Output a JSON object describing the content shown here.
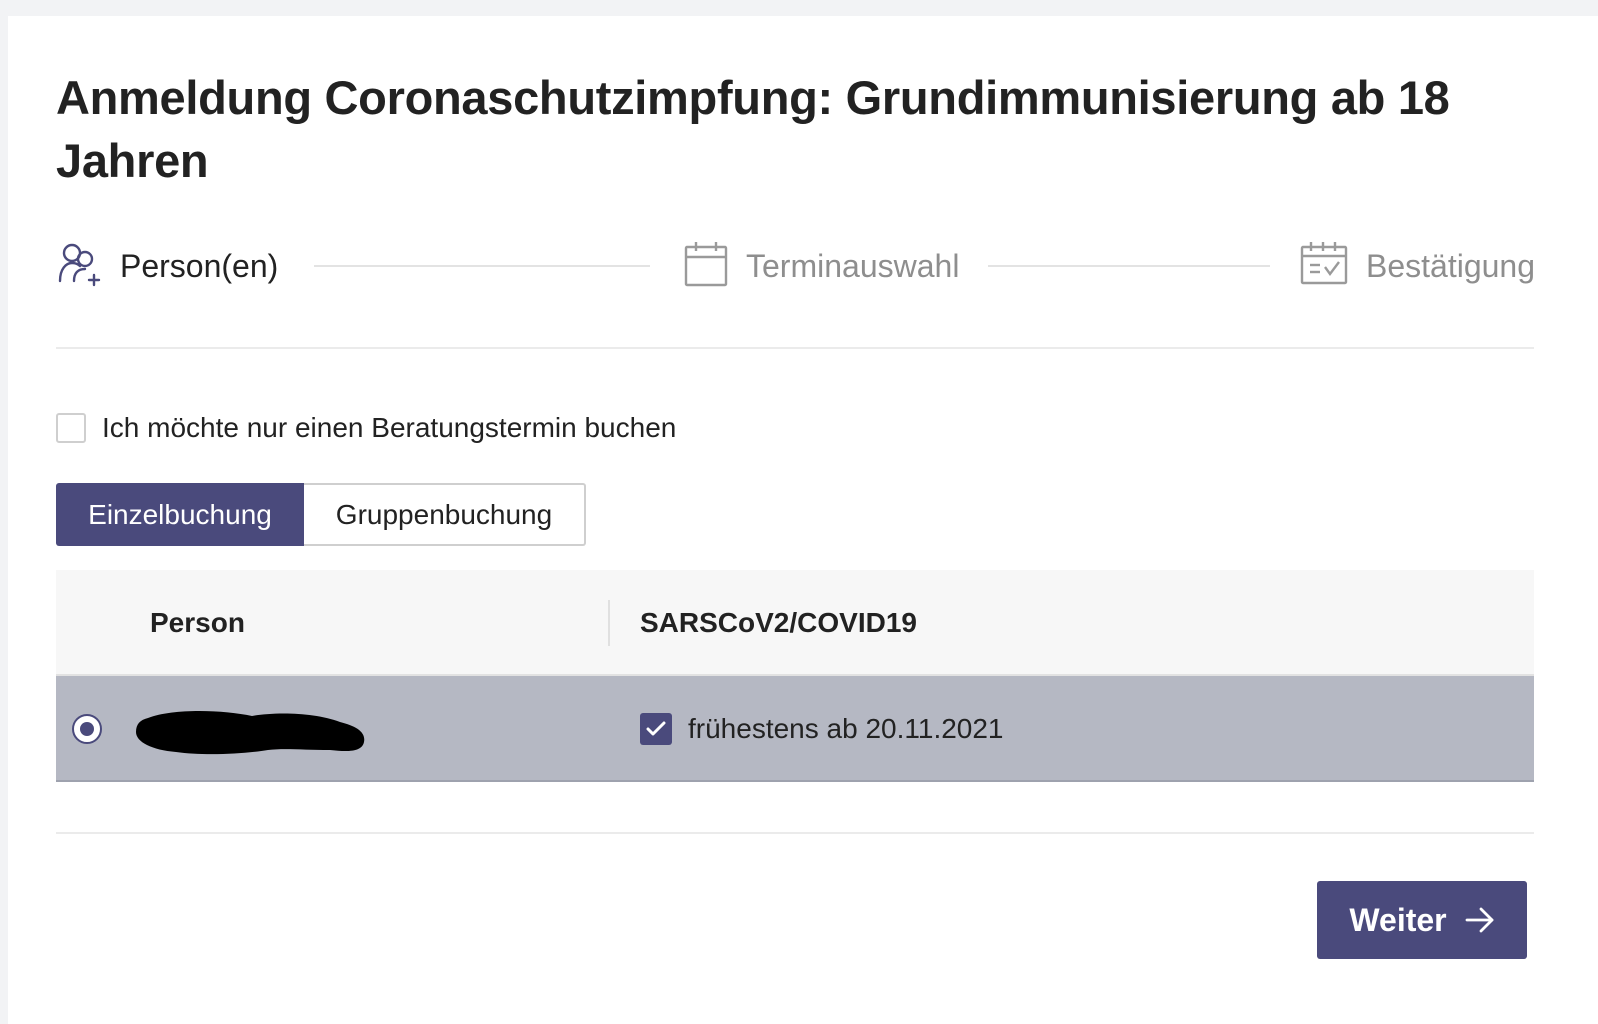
{
  "page": {
    "title": "Anmeldung Coronaschutzimpfung: Grundimmunisierung ab 18 Jahren"
  },
  "stepper": {
    "steps": [
      {
        "label": "Person(en)",
        "icon": "person-add-icon",
        "state": "active"
      },
      {
        "label": "Terminauswahl",
        "icon": "calendar-icon",
        "state": "inactive"
      },
      {
        "label": "Bestätigung",
        "icon": "calendar-check-icon",
        "state": "inactive"
      }
    ]
  },
  "consultation": {
    "label": "Ich möchte nur einen Beratungstermin buchen",
    "checked": false
  },
  "booking_type": {
    "options": [
      "Einzelbuchung",
      "Gruppenbuchung"
    ],
    "selected": "Einzelbuchung"
  },
  "table": {
    "headers": {
      "person": "Person",
      "vaccine": "SARSCoV2/COVID19"
    },
    "rows": [
      {
        "selected": true,
        "person_redacted": true,
        "vaccine_checked": true,
        "vaccine_label": "frühestens ab 20.11.2021"
      }
    ]
  },
  "actions": {
    "next_label": "Weiter",
    "next_icon": "arrow-right-icon"
  },
  "colors": {
    "primary": "#4a4a7c",
    "row_selected": "#b5b8c3",
    "muted_text": "#8e8e8e"
  }
}
